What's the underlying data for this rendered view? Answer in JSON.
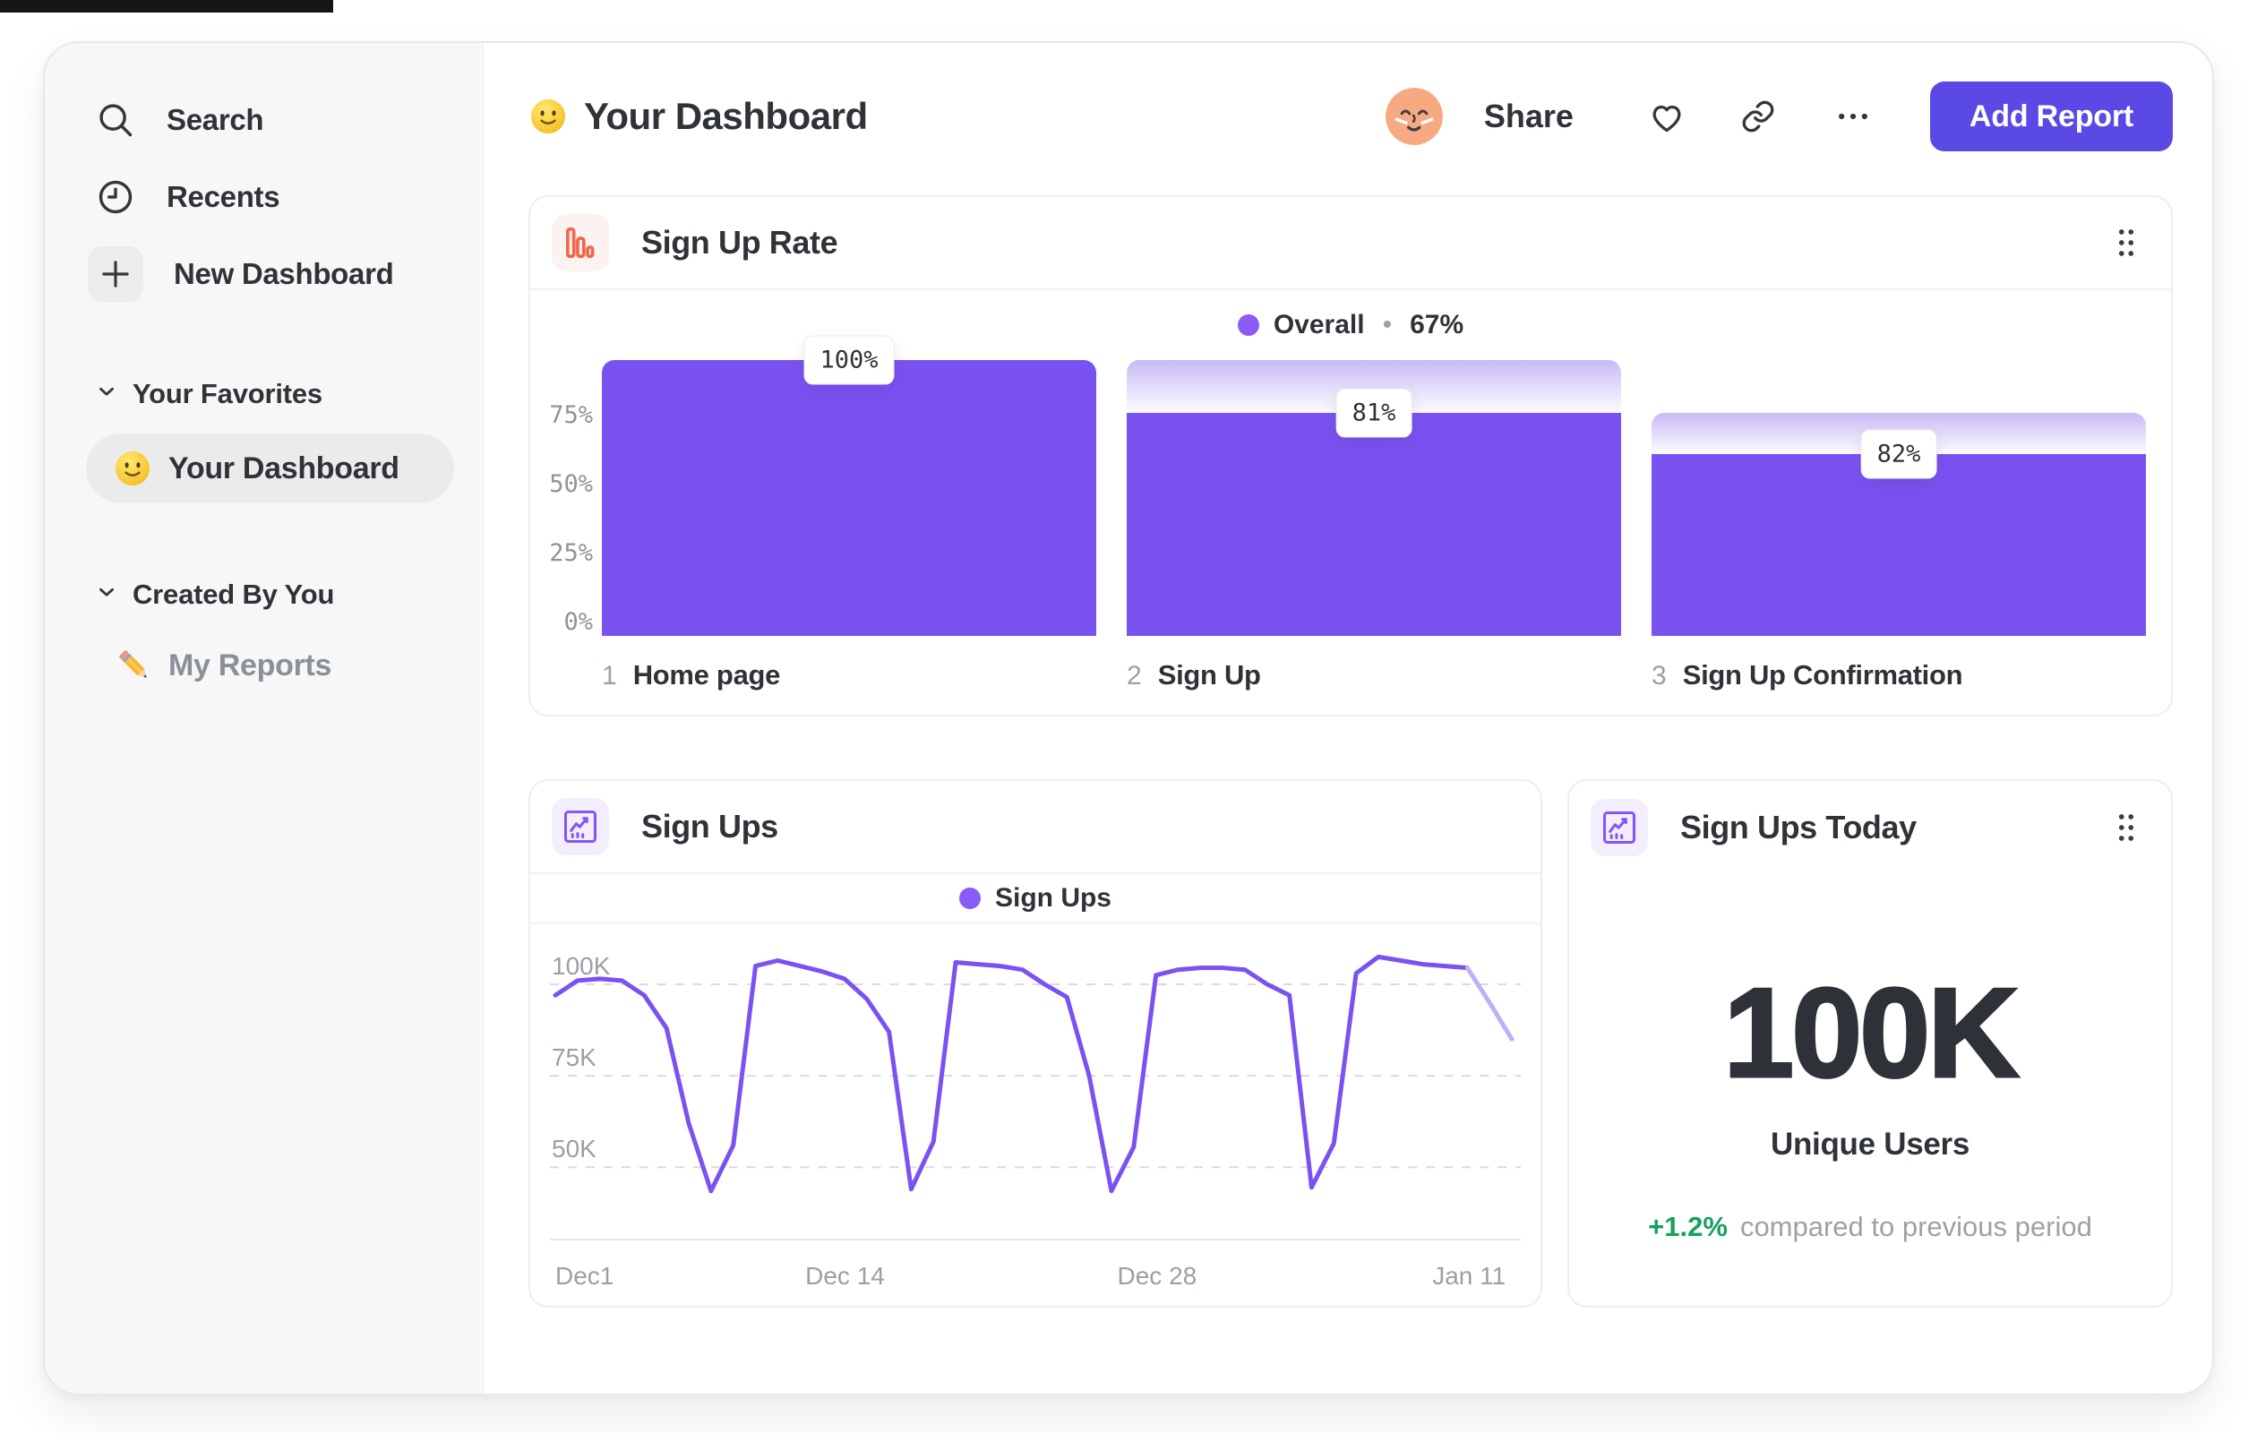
{
  "sidebar": {
    "items": [
      {
        "label": "Search",
        "icon": "search-icon"
      },
      {
        "label": "Recents",
        "icon": "clock-icon"
      },
      {
        "label": "New Dashboard",
        "icon": "plus-icon"
      }
    ],
    "sections": [
      {
        "label": "Your Favorites",
        "items": [
          {
            "label": "Your Dashboard",
            "icon": "smiley-emoji",
            "selected": true
          }
        ]
      },
      {
        "label": "Created By You",
        "items": [
          {
            "label": "My Reports",
            "icon": "pencil-emoji",
            "selected": false
          }
        ]
      }
    ]
  },
  "header": {
    "title_emoji": "smiley-emoji",
    "title": "Your Dashboard",
    "share_label": "Share",
    "add_report_label": "Add Report",
    "icons": [
      "avatar",
      "heart-icon",
      "link-icon",
      "ellipsis-icon"
    ]
  },
  "colors": {
    "accent_purple": "#7B52F2",
    "legend_dot_purple": "#8A5CF5",
    "faded_line_purple": "#BFAFF8",
    "button_purple": "#5A49E4",
    "icon_orange": "#F26749",
    "positive_green": "#17A05E",
    "gray_text": "#9CA1A8",
    "dark_text": "#2F3338"
  },
  "chart_data": [
    {
      "type": "bar",
      "subtype": "funnel",
      "title": "Sign Up Rate",
      "icon": "bar-chart-icon",
      "legend": {
        "label": "Overall",
        "separator": "•",
        "value_label": "67%"
      },
      "ylim": [
        0,
        100
      ],
      "y_ticks": [
        "75%",
        "50%",
        "25%",
        "0%"
      ],
      "grid": false,
      "steps": [
        {
          "step": "1",
          "label": "Home page",
          "overall_pct": 100,
          "col_top_pct": 100,
          "tooltip": "100%"
        },
        {
          "step": "2",
          "label": "Sign Up",
          "overall_pct": 81,
          "col_top_pct": 100,
          "tooltip": "81%"
        },
        {
          "step": "3",
          "label": "Sign Up Confirmation",
          "overall_pct": 66,
          "col_top_pct": 81,
          "tooltip": "82%"
        }
      ]
    },
    {
      "type": "line",
      "title": "Sign Ups",
      "icon": "line-chart-icon",
      "legend": "Sign Ups",
      "ylabel": "",
      "unit": "K",
      "ylim": [
        30,
        112
      ],
      "grid": "dashed-horizontal",
      "y_gridlines": [
        {
          "label": "100K",
          "value": 100
        },
        {
          "label": "75K",
          "value": 75
        },
        {
          "label": "50K",
          "value": 50
        }
      ],
      "x_ticks": [
        {
          "label": "Dec1",
          "day": 0
        },
        {
          "label": "Dec 14",
          "day": 13
        },
        {
          "label": "Dec 28",
          "day": 27
        },
        {
          "label": "Jan 11",
          "day": 41
        }
      ],
      "x_days_total": 43,
      "values_thousands": [
        97,
        101,
        101.5,
        101,
        97,
        88,
        62,
        43.5,
        56,
        105,
        106.5,
        105,
        103.5,
        101.5,
        96,
        87,
        44,
        57,
        106,
        105.5,
        105,
        104,
        100,
        96.5,
        75,
        43.5,
        55.5,
        102.5,
        104,
        104.5,
        104.5,
        104,
        100,
        97,
        44.5,
        56.5,
        103,
        107.5,
        106.5,
        105.5,
        105,
        104.5,
        95,
        85
      ],
      "faded_from_index": 41
    },
    {
      "type": "stat",
      "title": "Sign Ups Today",
      "icon": "line-chart-icon",
      "value": "100K",
      "label": "Unique Users",
      "delta": "+1.2%",
      "delta_note": "compared to previous period"
    }
  ]
}
